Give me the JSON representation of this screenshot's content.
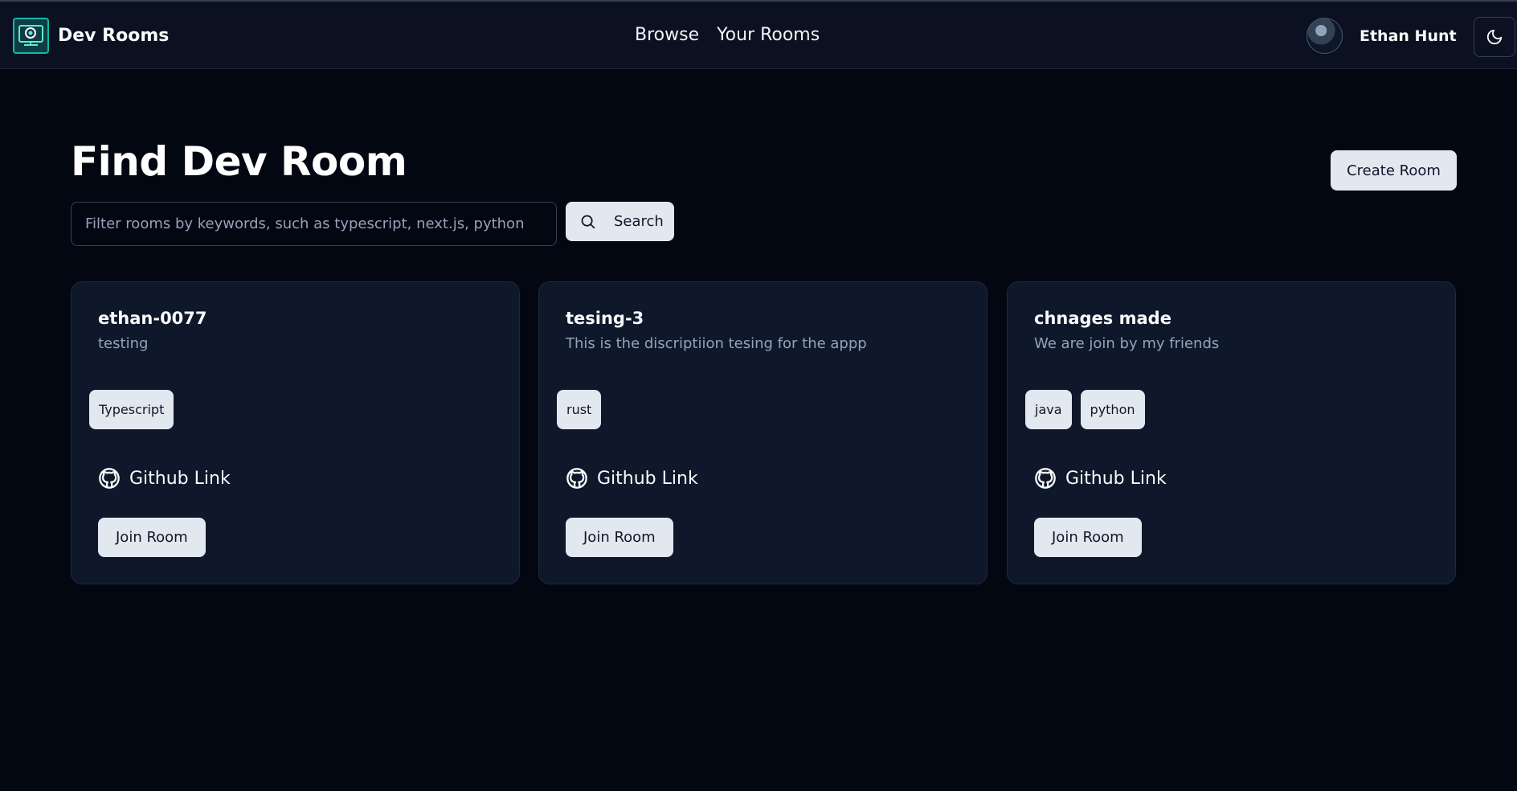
{
  "header": {
    "app_title": "Dev Rooms",
    "nav": [
      {
        "label": "Browse"
      },
      {
        "label": "Your Rooms"
      }
    ],
    "user_name": "Ethan Hunt",
    "theme_icon": "moon-icon"
  },
  "main": {
    "page_title": "Find Dev Room",
    "create_button": "Create Room",
    "search": {
      "placeholder": "Filter rooms by keywords, such as typescript, next.js, python",
      "value": "",
      "button_label": "Search"
    },
    "rooms": [
      {
        "name": "ethan-0077",
        "description": "testing",
        "tags": [
          "Typescript"
        ],
        "github_label": "Github Link",
        "join_label": "Join Room"
      },
      {
        "name": "tesing-3",
        "description": "This is the discriptiion tesing for the appp",
        "tags": [
          "rust"
        ],
        "github_label": "Github Link",
        "join_label": "Join Room"
      },
      {
        "name": "chnages made",
        "description": "We are join by my friends",
        "tags": [
          "java",
          "python"
        ],
        "github_label": "Github Link",
        "join_label": "Join Room"
      }
    ]
  },
  "colors": {
    "background": "#030712",
    "header_bg": "#0b1120",
    "card_bg": "#0f172a",
    "button_bg": "#e2e8f0",
    "muted_text": "#94a3b8",
    "logo_accent": "#14b8a6"
  }
}
